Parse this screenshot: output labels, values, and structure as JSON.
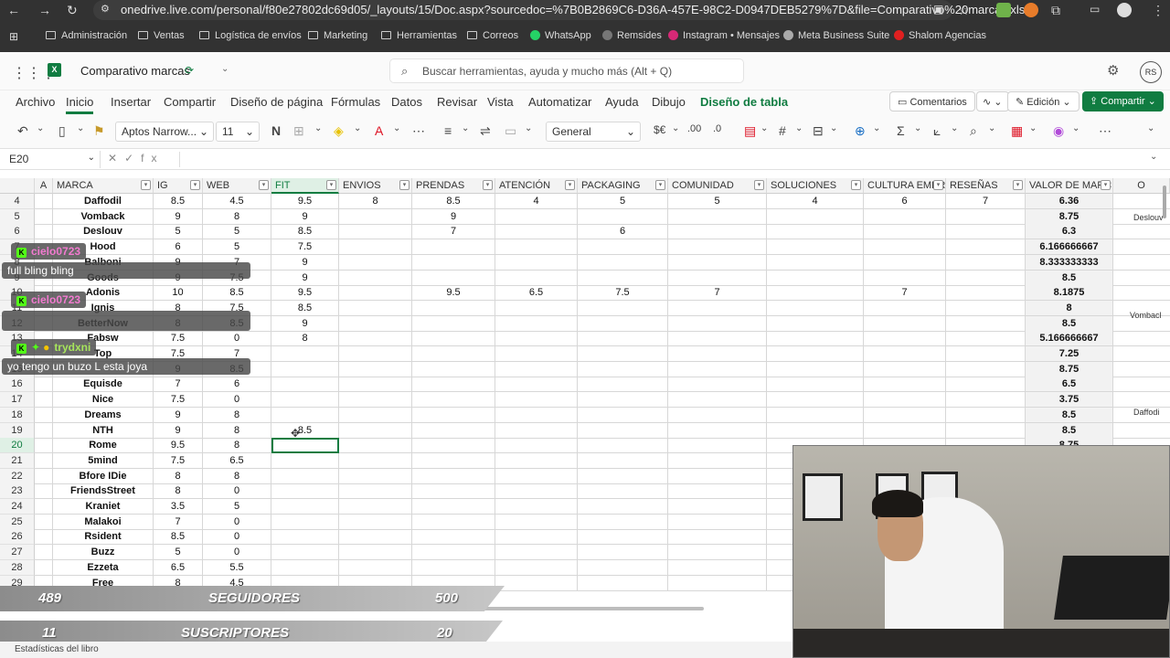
{
  "browser": {
    "url": "onedrive.live.com/personal/f80e27802dc69d05/_layouts/15/Doc.aspx?sourcedoc=%7B0B2869C6-D36A-457E-98C2-D0947DEB5279%7D&file=Comparativo%20marcas.xls...",
    "bookmarks": [
      "Administración",
      "Ventas",
      "Logística de envíos",
      "Marketing",
      "Herramientas",
      "Correos",
      "WhatsApp",
      "Remsides",
      "Instagram • Mensajes",
      "Meta Business Suite",
      "Shalom Agencias"
    ]
  },
  "app": {
    "title": "Comparativo marcas",
    "search_placeholder": "Buscar herramientas, ayuda y mucho más (Alt + Q)",
    "avatar_initials": "RS"
  },
  "menu": {
    "tabs": [
      "Archivo",
      "Inicio",
      "Insertar",
      "Compartir",
      "Diseño de página",
      "Fórmulas",
      "Datos",
      "Revisar",
      "Vista",
      "Automatizar",
      "Ayuda",
      "Dibujo",
      "Diseño de tabla"
    ],
    "comments": "Comentarios",
    "edit_mode": "Edición",
    "share": "Compartir"
  },
  "toolbar": {
    "font": "Aptos Narrow...",
    "font_size": "11",
    "bold": "N",
    "number_format": "General"
  },
  "formula_bar": {
    "cell_ref": "E20",
    "fx": "fx"
  },
  "sheet": {
    "col_letters": [
      "A",
      "O"
    ],
    "columns": [
      "MARCA",
      "IG",
      "WEB",
      "FIT",
      "ENVIOS",
      "PRENDAS",
      "ATENCIÓN",
      "PACKAGING",
      "COMUNIDAD",
      "SOLUCIONES",
      "CULTURA EMPR",
      "RESEÑAS",
      "VALOR DE MARC"
    ],
    "rows": [
      {
        "n": "4",
        "cells": [
          "Daffodil",
          "8.5",
          "4.5",
          "9.5",
          "8",
          "8.5",
          "4",
          "5",
          "5",
          "4",
          "6",
          "7",
          "6.36"
        ]
      },
      {
        "n": "5",
        "cells": [
          "Vomback",
          "9",
          "8",
          "9",
          "",
          "9",
          "",
          "",
          "",
          "",
          "",
          "",
          "8.75"
        ]
      },
      {
        "n": "6",
        "cells": [
          "Deslouv",
          "5",
          "5",
          "8.5",
          "",
          "7",
          "",
          "6",
          "",
          "",
          "",
          "",
          "6.3"
        ]
      },
      {
        "n": "7",
        "cells": [
          "Hood",
          "6",
          "5",
          "7.5",
          "",
          "",
          "",
          "",
          "",
          "",
          "",
          "",
          "6.166666667"
        ]
      },
      {
        "n": "8",
        "cells": [
          "Balboni",
          "9",
          "7",
          "9",
          "",
          "",
          "",
          "",
          "",
          "",
          "",
          "",
          "8.333333333"
        ]
      },
      {
        "n": "9",
        "cells": [
          "Goods",
          "9",
          "7.5",
          "9",
          "",
          "",
          "",
          "",
          "",
          "",
          "",
          "",
          "8.5"
        ]
      },
      {
        "n": "10",
        "cells": [
          "Adonis",
          "10",
          "8.5",
          "9.5",
          "",
          "9.5",
          "6.5",
          "7.5",
          "7",
          "",
          "7",
          "",
          "8.1875"
        ]
      },
      {
        "n": "11",
        "cells": [
          "Ignis",
          "8",
          "7.5",
          "8.5",
          "",
          "",
          "",
          "",
          "",
          "",
          "",
          "",
          "8"
        ]
      },
      {
        "n": "12",
        "cells": [
          "BetterNow",
          "8",
          "8.5",
          "9",
          "",
          "",
          "",
          "",
          "",
          "",
          "",
          "",
          "8.5"
        ]
      },
      {
        "n": "13",
        "cells": [
          "Fabsw",
          "7.5",
          "0",
          "8",
          "",
          "",
          "",
          "",
          "",
          "",
          "",
          "",
          "5.166666667"
        ]
      },
      {
        "n": "14",
        "cells": [
          "Top",
          "7.5",
          "7",
          "",
          "",
          "",
          "",
          "",
          "",
          "",
          "",
          "",
          "7.25"
        ]
      },
      {
        "n": "15",
        "cells": [
          "",
          "9",
          "8.5",
          "",
          "",
          "",
          "",
          "",
          "",
          "",
          "",
          "",
          "8.75"
        ]
      },
      {
        "n": "16",
        "cells": [
          "Equisde",
          "7",
          "6",
          "",
          "",
          "",
          "",
          "",
          "",
          "",
          "",
          "",
          "6.5"
        ]
      },
      {
        "n": "17",
        "cells": [
          "Nice",
          "7.5",
          "0",
          "",
          "",
          "",
          "",
          "",
          "",
          "",
          "",
          "",
          "3.75"
        ]
      },
      {
        "n": "18",
        "cells": [
          "Dreams",
          "9",
          "8",
          "",
          "",
          "",
          "",
          "",
          "",
          "",
          "",
          "",
          "8.5"
        ]
      },
      {
        "n": "19",
        "cells": [
          "NTH",
          "9",
          "8",
          "8.5",
          "",
          "",
          "",
          "",
          "",
          "",
          "",
          "",
          "8.5"
        ]
      },
      {
        "n": "20",
        "cells": [
          "Rome",
          "9.5",
          "8",
          "",
          "",
          "",
          "",
          "",
          "",
          "",
          "",
          "",
          "8.75"
        ]
      },
      {
        "n": "21",
        "cells": [
          "5mind",
          "7.5",
          "6.5",
          "",
          "",
          "",
          "",
          "",
          "",
          "",
          "",
          "",
          ""
        ]
      },
      {
        "n": "22",
        "cells": [
          "Bfore IDie",
          "8",
          "8",
          "",
          "",
          "",
          "",
          "",
          "",
          "",
          "",
          "",
          ""
        ]
      },
      {
        "n": "23",
        "cells": [
          "FriendsStreet",
          "8",
          "0",
          "",
          "",
          "",
          "",
          "",
          "",
          "",
          "",
          "",
          ""
        ]
      },
      {
        "n": "24",
        "cells": [
          "Kraniet",
          "3.5",
          "5",
          "",
          "",
          "",
          "",
          "",
          "",
          "",
          "",
          "",
          ""
        ]
      },
      {
        "n": "25",
        "cells": [
          "Malakoi",
          "7",
          "0",
          "",
          "",
          "",
          "",
          "",
          "",
          "",
          "",
          "",
          ""
        ]
      },
      {
        "n": "26",
        "cells": [
          "Rsident",
          "8.5",
          "0",
          "",
          "",
          "",
          "",
          "",
          "",
          "",
          "",
          "",
          ""
        ]
      },
      {
        "n": "27",
        "cells": [
          "Buzz",
          "5",
          "0",
          "",
          "",
          "",
          "",
          "",
          "",
          "",
          "",
          "",
          ""
        ]
      },
      {
        "n": "28",
        "cells": [
          "Ezzeta",
          "6.5",
          "5.5",
          "",
          "",
          "",
          "",
          "",
          "",
          "",
          "",
          "",
          ""
        ]
      },
      {
        "n": "29",
        "cells": [
          "Free",
          "8",
          "4.5",
          "",
          "",
          "",
          "",
          "",
          "",
          "",
          "",
          "",
          ""
        ]
      }
    ],
    "side_labels": [
      "Deslouv",
      "Vombacl",
      "Daffodi"
    ],
    "status": "Estadísticas del libro"
  },
  "chat": [
    {
      "user": "cielo0723",
      "message": "full bling bling"
    },
    {
      "user": "cielo0723",
      "message": ""
    },
    {
      "user": "trydxni",
      "message": "yo tengo un buzo L esta joya"
    }
  ],
  "overlay": {
    "followers_current": "489",
    "followers_label": "SEGUIDORES",
    "followers_goal": "500",
    "subs_current": "11",
    "subs_label": "SUSCRIPTORES",
    "subs_goal": "20"
  },
  "colors": {
    "excel_green": "#107c41",
    "chrome_dark": "#323232",
    "chat_user": "#f27ad0",
    "chat_user2": "#a6e45c"
  }
}
